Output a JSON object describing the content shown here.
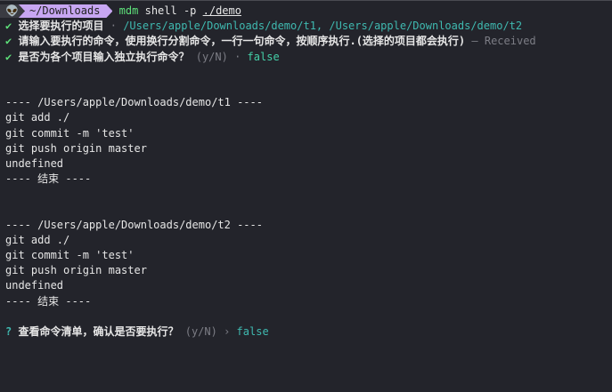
{
  "prompt": {
    "icon": "alien-icon",
    "directory": "~/Downloads",
    "command": "mdm",
    "args": "shell -p",
    "path": "./demo"
  },
  "answers": [
    {
      "mark": "✔",
      "question": "选择要执行的项目",
      "sep": "·",
      "answer": "/Users/apple/Downloads/demo/t1, /Users/apple/Downloads/demo/t2"
    },
    {
      "mark": "✔",
      "question": "请输入要执行的命令，使用换行分割命令，一行一句命令，按顺序执行.(选择的项目都会执行)",
      "sep": "—",
      "answer": "Received"
    },
    {
      "mark": "✔",
      "question": "是否为各个项目输入独立执行命令？",
      "hint": "(y/N)",
      "sep": "·",
      "answer": "false"
    }
  ],
  "blocks": [
    {
      "header": "---- /Users/apple/Downloads/demo/t1 ----",
      "lines": [
        "git add ./",
        "git commit -m 'test'",
        "git push origin master",
        "undefined"
      ],
      "footer": "---- 结束 ----"
    },
    {
      "header": "---- /Users/apple/Downloads/demo/t2 ----",
      "lines": [
        "git add ./",
        "git commit -m 'test'",
        "git push origin master",
        "undefined"
      ],
      "footer": "---- 结束 ----"
    }
  ],
  "final": {
    "mark": "?",
    "question": "查看命令清单，确认是否要执行？",
    "hint": "(y/N)",
    "sep": "›",
    "answer": "false"
  },
  "colors": {
    "background": "#23242b",
    "check": "#5ee07a",
    "answer": "#3fb9b0",
    "dirSegment": "#c7a6f2"
  }
}
